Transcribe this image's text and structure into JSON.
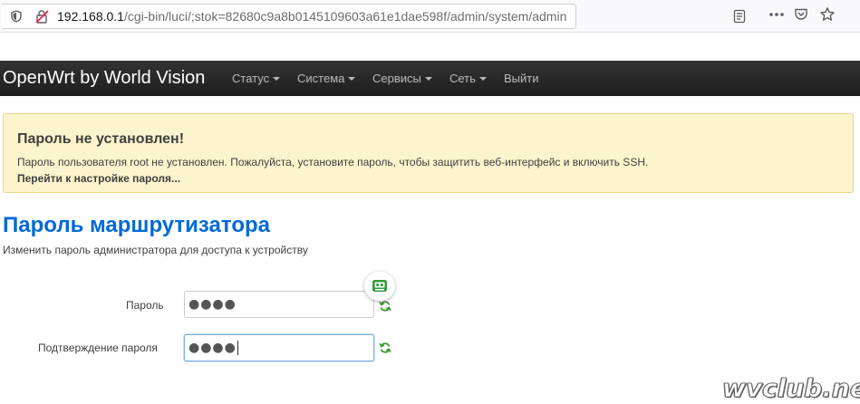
{
  "browser": {
    "url_host": "192.168.0.1",
    "url_path": "/cgi-bin/luci/;stok=82680c9a8b0145109603a61e1dae598f/admin/system/admin",
    "icons": [
      "tracking-shield-icon",
      "insecure-connection-icon",
      "reader-view-icon",
      "more-actions-icon",
      "pocket-icon",
      "bookmark-star-icon"
    ]
  },
  "navbar": {
    "brand": "OpenWrt by World Vision",
    "items": [
      {
        "label": "Статус",
        "dropdown": true
      },
      {
        "label": "Система",
        "dropdown": true
      },
      {
        "label": "Сервисы",
        "dropdown": true
      },
      {
        "label": "Сеть",
        "dropdown": true
      },
      {
        "label": "Выйти",
        "dropdown": false
      }
    ]
  },
  "alert": {
    "title": "Пароль не установлен!",
    "text": "Пароль пользователя root не установлен. Пожалуйста, установите пароль, чтобы защитить веб-интерфейс и включить SSH.",
    "link": "Перейти к настройке пароля..."
  },
  "page": {
    "title": "Пароль маршрутизатора",
    "description": "Изменить пароль администратора для доступа к устройству"
  },
  "form": {
    "password_label": "Пароль",
    "password_value": "●●●●",
    "confirm_label": "Подтверждение пароля",
    "confirm_value": "●●●●"
  },
  "watermark": "wvclub.net",
  "colors": {
    "navbar_bg": "#222222",
    "alert_bg": "#fcf4cc",
    "title_blue": "#0069d6",
    "reload_green": "#3a9a2a"
  }
}
